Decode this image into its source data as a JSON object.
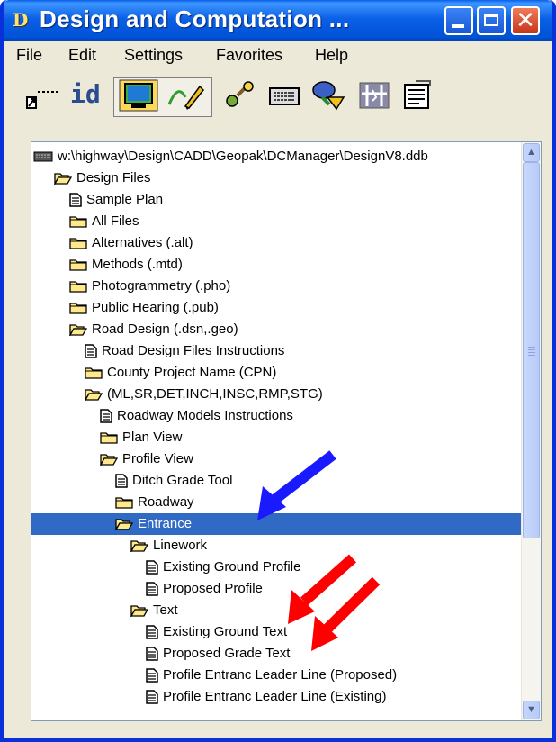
{
  "window": {
    "title": "Design and Computation ...",
    "app_icon_glyph": "D",
    "titlebar_color": "#0054e3",
    "close_glyph": "✕"
  },
  "menu": [
    "File",
    "Edit",
    "Settings",
    "Favorites",
    "Help"
  ],
  "toolbar": {
    "id_label": "id",
    "tools": [
      "key-in-icon",
      "id-icon",
      "monitor-icon",
      "draw-icon",
      "tools-icon",
      "keyboard-icon",
      "query-icon",
      "cross-section-icon",
      "properties-icon"
    ]
  },
  "tree": {
    "root": "w:\\highway\\Design\\CADD\\Geopak\\DCManager\\DesignV8.ddb",
    "items": [
      {
        "label": "Design Files",
        "icon": "folder-open-icon"
      },
      {
        "label": "Sample Plan",
        "icon": "document-icon"
      },
      {
        "label": "All Files",
        "icon": "folder-icon"
      },
      {
        "label": "Alternatives (.alt)",
        "icon": "folder-icon"
      },
      {
        "label": "Methods (.mtd)",
        "icon": "folder-icon"
      },
      {
        "label": "Photogrammetry (.pho)",
        "icon": "folder-icon"
      },
      {
        "label": "Public Hearing (.pub)",
        "icon": "folder-icon"
      },
      {
        "label": "Road Design (.dsn,.geo)",
        "icon": "folder-open-icon"
      },
      {
        "label": "Road Design Files Instructions",
        "icon": "document-icon"
      },
      {
        "label": "County Project Name (CPN)",
        "icon": "folder-icon"
      },
      {
        "label": "(ML,SR,DET,INCH,INSC,RMP,STG)",
        "icon": "folder-open-icon"
      },
      {
        "label": "Roadway Models Instructions",
        "icon": "document-icon"
      },
      {
        "label": "Plan View",
        "icon": "folder-icon"
      },
      {
        "label": "Profile View",
        "icon": "folder-open-icon"
      },
      {
        "label": "Ditch Grade Tool",
        "icon": "document-icon"
      },
      {
        "label": "Roadway",
        "icon": "folder-icon"
      },
      {
        "label": "Entrance",
        "icon": "folder-open-icon",
        "selected": true
      },
      {
        "label": "Linework",
        "icon": "folder-open-icon"
      },
      {
        "label": "Existing Ground Profile",
        "icon": "document-icon"
      },
      {
        "label": "Proposed Profile",
        "icon": "document-icon"
      },
      {
        "label": "Text",
        "icon": "folder-open-icon"
      },
      {
        "label": "Existing Ground Text",
        "icon": "document-icon"
      },
      {
        "label": "Proposed Grade Text",
        "icon": "document-icon"
      },
      {
        "label": "Profile Entranc Leader Line (Proposed)",
        "icon": "document-icon"
      },
      {
        "label": "Profile Entranc Leader Line (Existing)",
        "icon": "document-icon"
      }
    ]
  },
  "colors": {
    "selection": "#316ac5",
    "blue_arrow": "#1a1aff",
    "red_arrow": "#ff0000",
    "folder_fill": "#ffe98a"
  }
}
